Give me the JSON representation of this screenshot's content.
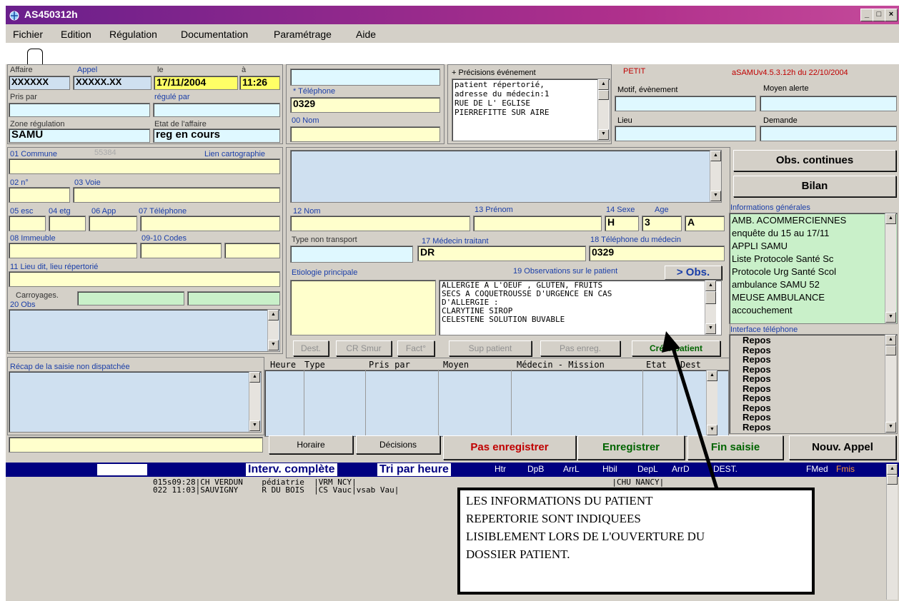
{
  "window": {
    "title": "AS450312h",
    "min": "_",
    "max": "□",
    "close": "×"
  },
  "menu": [
    "Fichier",
    "Edition",
    "Régulation",
    "Documentation",
    "Paramétrage",
    "Aide"
  ],
  "affaire": {
    "affaire_label": "Affaire",
    "appel_label": "Appel",
    "le_label": "le",
    "a_label": "à",
    "affaire_value": "XXXXXX",
    "appel_value": "XXXXX.XX",
    "date": "17/11/2004",
    "time": "11:26",
    "pris_par_label": "Pris par",
    "regule_par_label": "régulé par",
    "zone_label": "Zone régulation",
    "zone_value": "SAMU",
    "etat_label": "Etat de l'affaire",
    "etat_value": "reg en cours"
  },
  "caller": {
    "telephone_label": "* Téléphone",
    "telephone_value": "0329",
    "nom_label": "00 Nom"
  },
  "event": {
    "precisions_label": "+ Précisions événement",
    "precisions_lines": [
      "patient répertorié,",
      "adresse du médecin:1",
      "RUE DE L' EGLISE",
      "PIERREFITTE SUR AIRE"
    ],
    "petit": "PETIT",
    "version": "aSAMUv4.5.3.12h du 22/10/2004",
    "motif_label": "Motif, évènement",
    "moyen_label": "Moyen alerte",
    "lieu_label": "Lieu",
    "demande_label": "Demande"
  },
  "address": {
    "commune_label": "01 Commune",
    "commune_code": "55384",
    "carto_label": "Lien cartographie",
    "n_label": "02 n°",
    "voie_label": "03 Voie",
    "esc_label": "05 esc",
    "etg_label": "04 etg",
    "app_label": "06 App",
    "tel_label": "07 Téléphone",
    "immeuble_label": "08 Immeuble",
    "codes_label": "09-10 Codes",
    "lieu_dit_label": "11 Lieu dit, lieu répertorié",
    "carroyages_label": "Carroyages.",
    "obs_label": "20 Obs"
  },
  "patient": {
    "nom_label": "12 Nom",
    "prenom_label": "13 Prénom",
    "sexe_label": "14 Sexe",
    "age_label": "Age",
    "sexe_value": "H",
    "age_value": "3",
    "age_unit": "A",
    "type_label": "Type non transport",
    "medecin_label": "17 Médecin traitant",
    "medecin_value": "DR",
    "tel_medecin_label": "18 Téléphone du médecin",
    "tel_medecin_value": "0329",
    "etiologie_label": "Etiologie principale",
    "obs_label": "19 Observations sur le patient",
    "obs_button": "> Obs.",
    "obs_lines": [
      "ALLERGIE A L'OEUF , GLUTEN, FRUITS",
      "SECS A COQUETROUSSE D'URGENCE EN CAS",
      "D'ALLERGIE :",
      " CLARYTINE SIROP",
      " CELESTENE SOLUTION BUVABLE"
    ]
  },
  "patient_buttons": {
    "dest": "Dest.",
    "cr_smur": "CR Smur",
    "fact": "Fact°",
    "sup": "Sup patient",
    "pas_enreg": "Pas enreg.",
    "creer": "Créer patient"
  },
  "right_panel": {
    "obs_continues": "Obs. continues",
    "bilan": "Bilan",
    "info_label": "Informations générales",
    "info_lines": [
      "AMB. ACOMMERCIENNES",
      "enquête du 15 au 17/11",
      "APPLI SAMU",
      "Liste Protocole Santé Sc",
      "Protocole Urg Santé Scol",
      "ambulance SAMU 52",
      "MEUSE AMBULANCE",
      "accouchement"
    ],
    "interface_label": "Interface téléphone",
    "repos": [
      "Repos",
      "Repos",
      "Repos",
      "Repos",
      "Repos",
      "Repos",
      "Repos",
      "Repos",
      "Repos",
      "Repos"
    ]
  },
  "recap": {
    "label": "Récap de la saisie non dispatchée"
  },
  "mission": {
    "header": [
      "Heure",
      "Type",
      "Pris par",
      "Moyen",
      "Médecin - Mission",
      "Etat",
      "Dest"
    ]
  },
  "bottom_buttons": {
    "horaire": "Horaire",
    "decisions": "Décisions",
    "pas_enregistrer": "Pas enregistrer",
    "enregistrer": "Enregistrer",
    "fin_saisie": "Fin saisie",
    "nouv_appel": "Nouv. Appel"
  },
  "status": {
    "interv": "Interv. complète",
    "tri": "Tri par heure",
    "cols": [
      "Htr",
      "DpB",
      "ArrL",
      "Hbil",
      "DepL",
      "ArrD",
      "DEST.",
      "FMed",
      "Fmis"
    ]
  },
  "interventions": [
    {
      "line1": "015s09:28|CH VERDUN    pédiatrie  |VRM NCY|                                                      |CHU NANCY|",
      "line2": "022 11:03|SAUVIGNY     R DU BOIS  |CS Vauc|vsab Vau|"
    }
  ],
  "callout": {
    "lines": [
      "LES INFORMATIONS DU PATIENT",
      "REPERTORIE SONT INDIQUEES",
      "LISIBLEMENT LORS DE L'OUVERTURE DU",
      "DOSSIER PATIENT."
    ]
  }
}
